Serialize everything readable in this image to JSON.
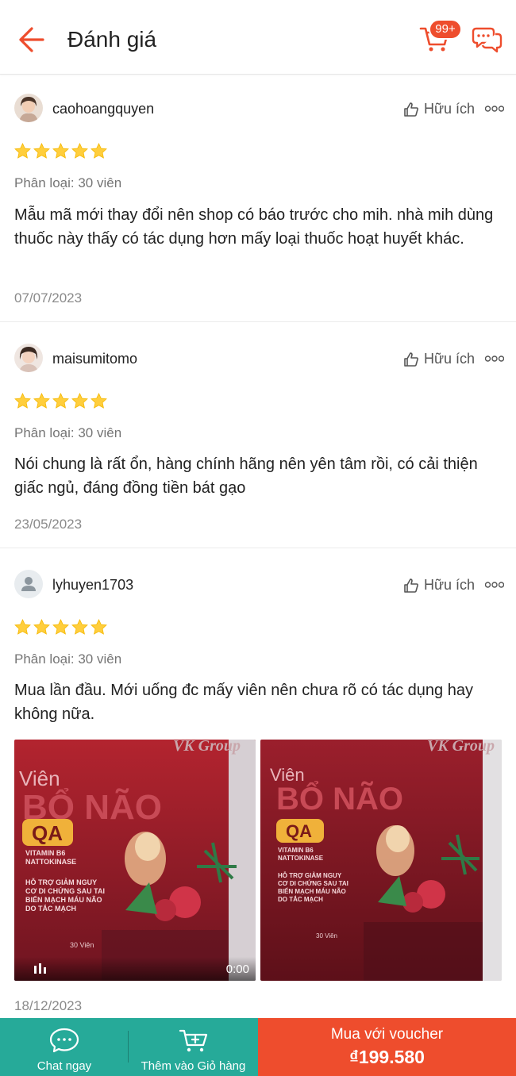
{
  "header": {
    "title": "Đánh giá",
    "cart_badge": "99+"
  },
  "reviews": [
    {
      "username": "caohoangquyen",
      "helpful_label": "Hữu ích",
      "rating": 5,
      "variant": "Phân loại: 30 viên",
      "comment": "Mẫu mã mới thay đổi nên shop có báo trước cho mih. nhà mih dùng thuốc này thấy có tác dụng hơn mấy loại thuốc hoạt huyết khác.",
      "date": "07/07/2023"
    },
    {
      "username": "maisumitomo",
      "helpful_label": "Hữu ích",
      "rating": 5,
      "variant": "Phân loại: 30 viên",
      "comment": "Nói chung là rất ổn, hàng chính hãng nên yên tâm rồi, có cải thiện giấc ngủ, đáng đồng tiền bát gạo",
      "date": "23/05/2023"
    },
    {
      "username": "lyhuyen1703",
      "helpful_label": "Hữu ích",
      "rating": 5,
      "variant": "Phân loại: 30 viên",
      "comment": "Mua lần đầu. Mới uống đc mấy viên nên chưa rõ có tác dụng hay không nữa.",
      "video_duration": "0:00",
      "date": "18/12/2023",
      "product_text": {
        "brand": "VK Group",
        "line1": "Viên",
        "line2": "BỔ NÃO",
        "badge": "QA",
        "sub1": "VITAMIN B6",
        "sub2": "NATTOKINASE",
        "claim1": "HỖ TRỢ GIẢM NGUY",
        "claim2": "CƠ DI CHỨNG SAU TAI",
        "claim3": "BIẾN MẠCH MÁU NÃO",
        "claim4": "DO TẮC MẠCH",
        "count": "30 Viên"
      }
    }
  ],
  "bottom_bar": {
    "chat_label": "Chat ngay",
    "cart_label": "Thêm vào Giỏ hàng",
    "buy_label": "Mua với voucher",
    "buy_price": "₫199.580"
  },
  "colors": {
    "accent": "#ee4d2d",
    "teal": "#26aa99",
    "star": "#ffce3d"
  }
}
